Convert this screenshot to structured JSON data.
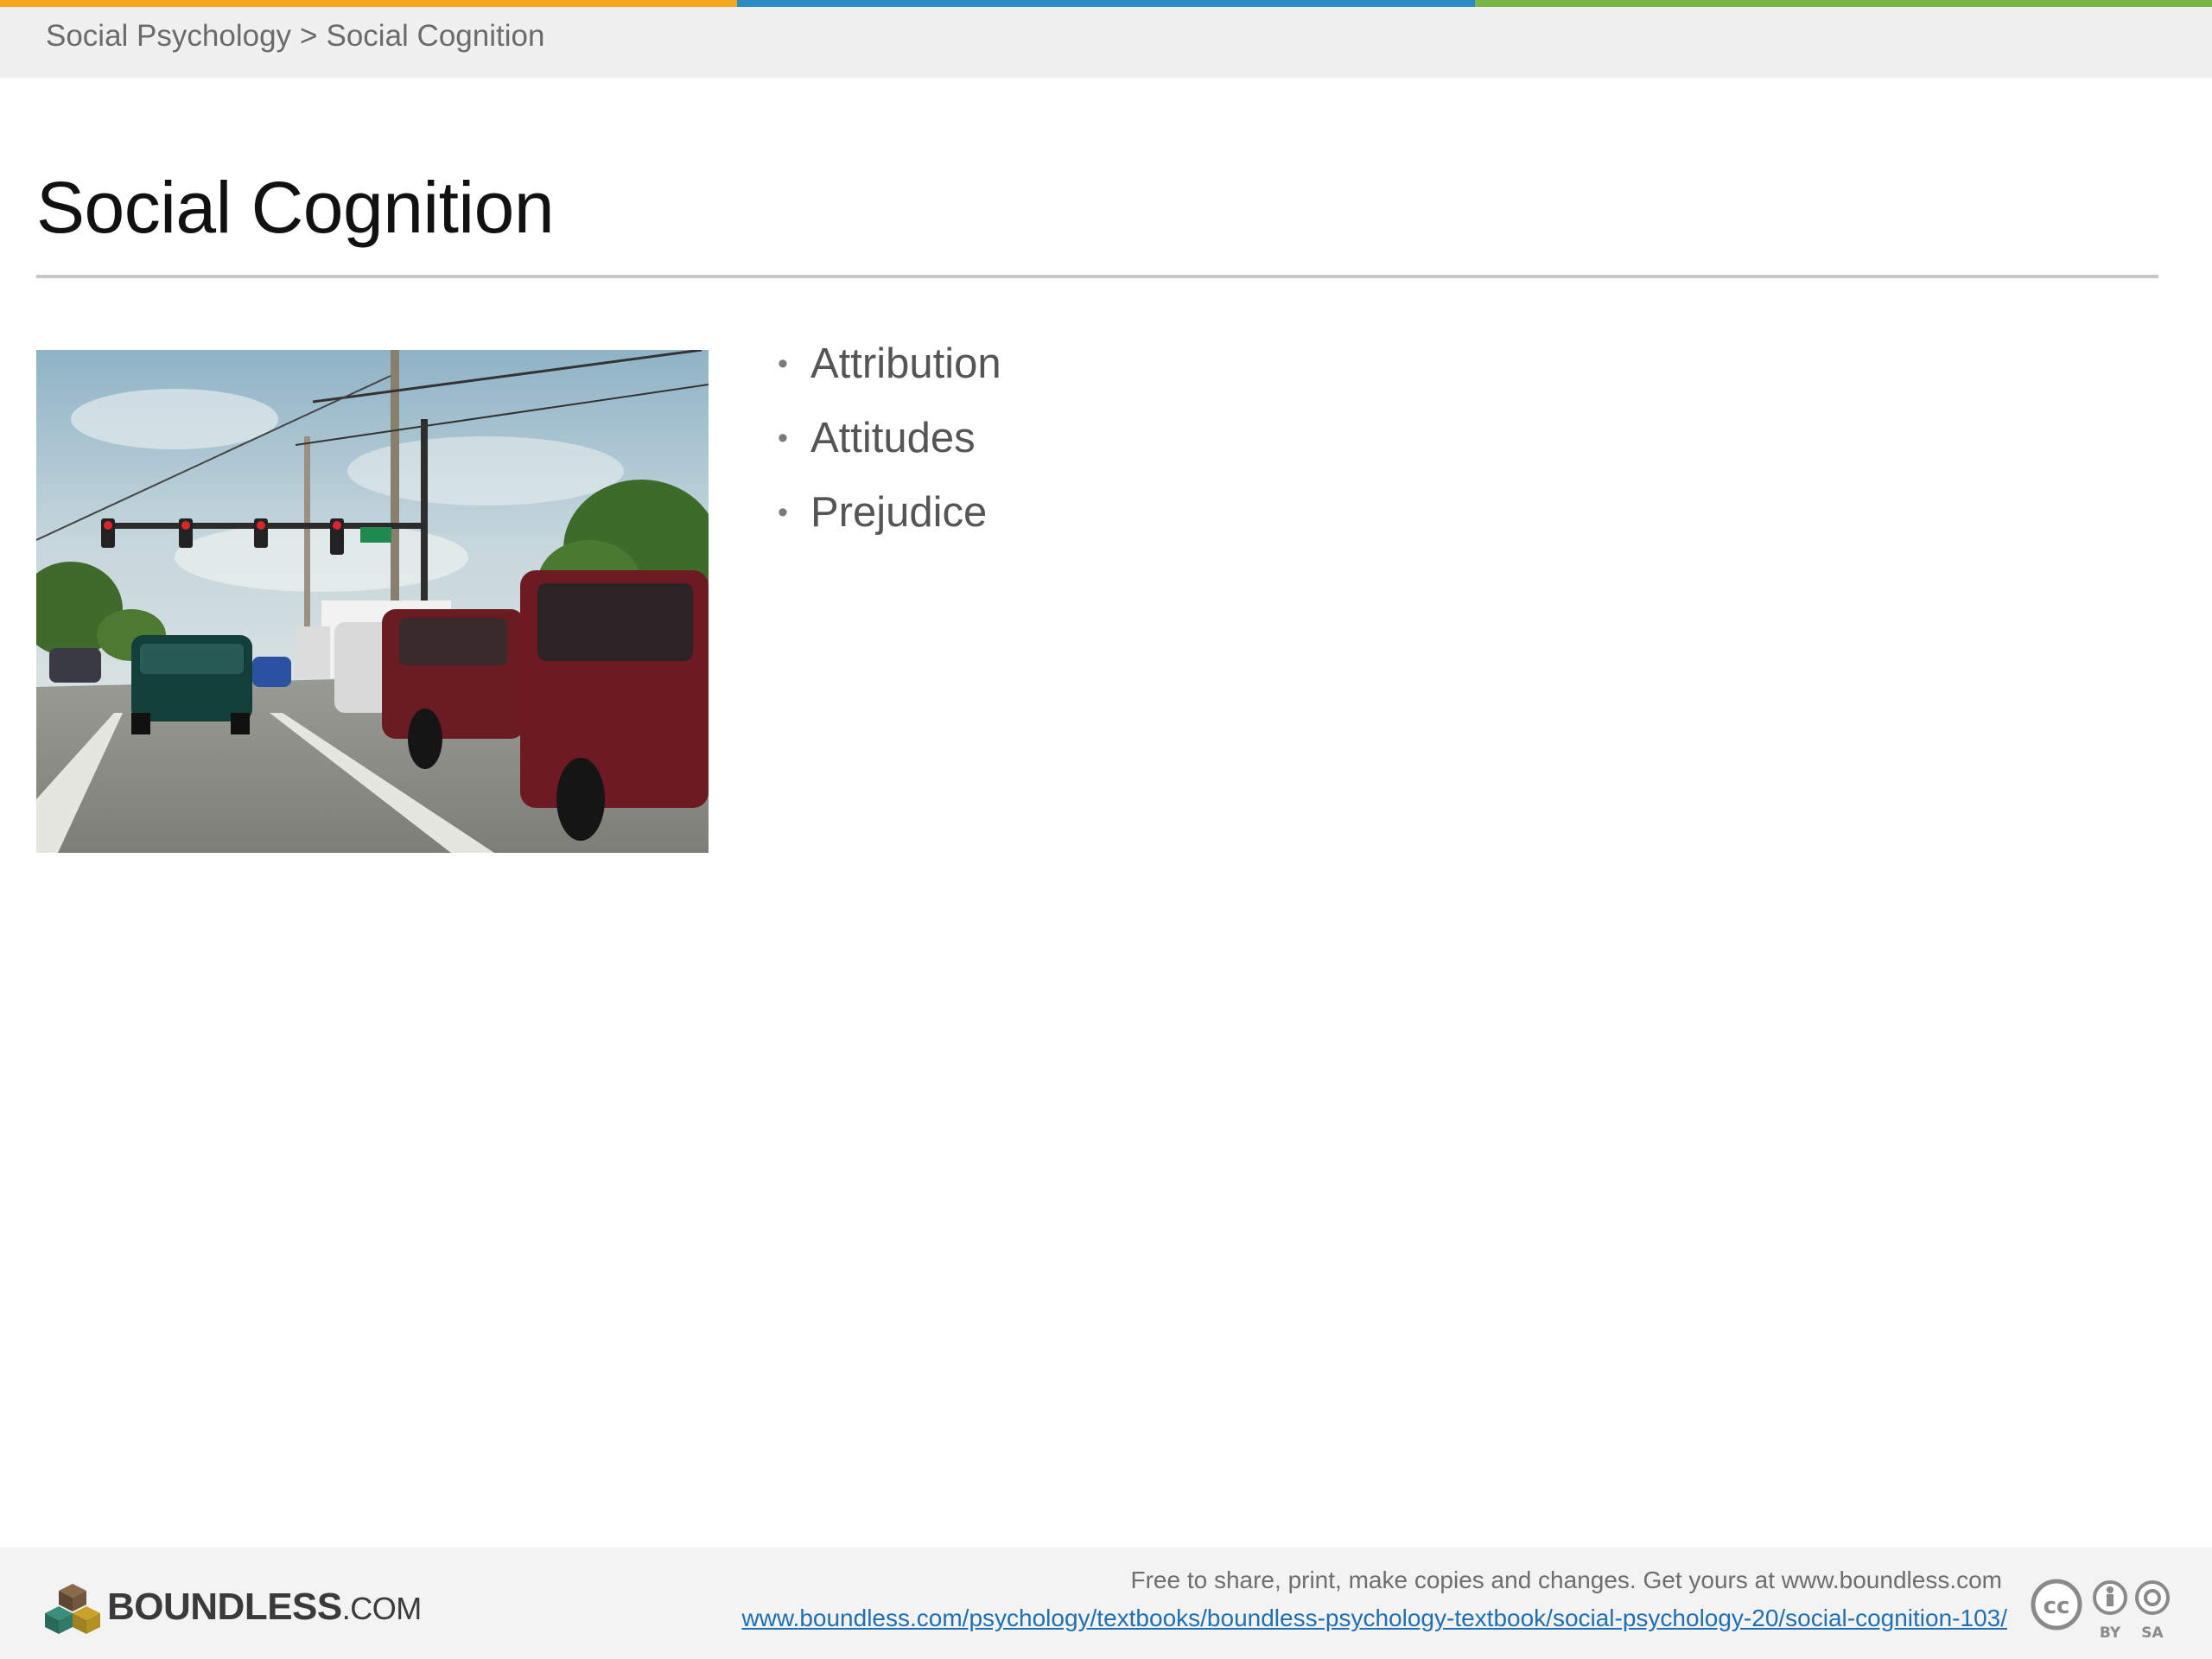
{
  "header": {
    "stripe_colors": [
      "#f4a71f",
      "#2b8cc4",
      "#7ab648"
    ],
    "breadcrumb": {
      "parent": "Social Psychology",
      "separator": ">",
      "current": "Social Cognition"
    }
  },
  "slide": {
    "title": "Social Cognition",
    "image_icon": "street-traffic-photo",
    "bullets": [
      "Attribution",
      "Attitudes",
      "Prejudice"
    ]
  },
  "footer": {
    "logo": {
      "icon": "boundless-cubes-logo",
      "name": "BOUNDLESS",
      "suffix": ".COM"
    },
    "note": "Free to share, print, make copies and changes. Get yours at www.boundless.com",
    "link": "www.boundless.com/psychology/textbooks/boundless-psychology-textbook/social-psychology-20/social-cognition-103/",
    "license": {
      "icon": "creative-commons-by-sa-icon",
      "by": "BY",
      "sa": "SA"
    }
  }
}
